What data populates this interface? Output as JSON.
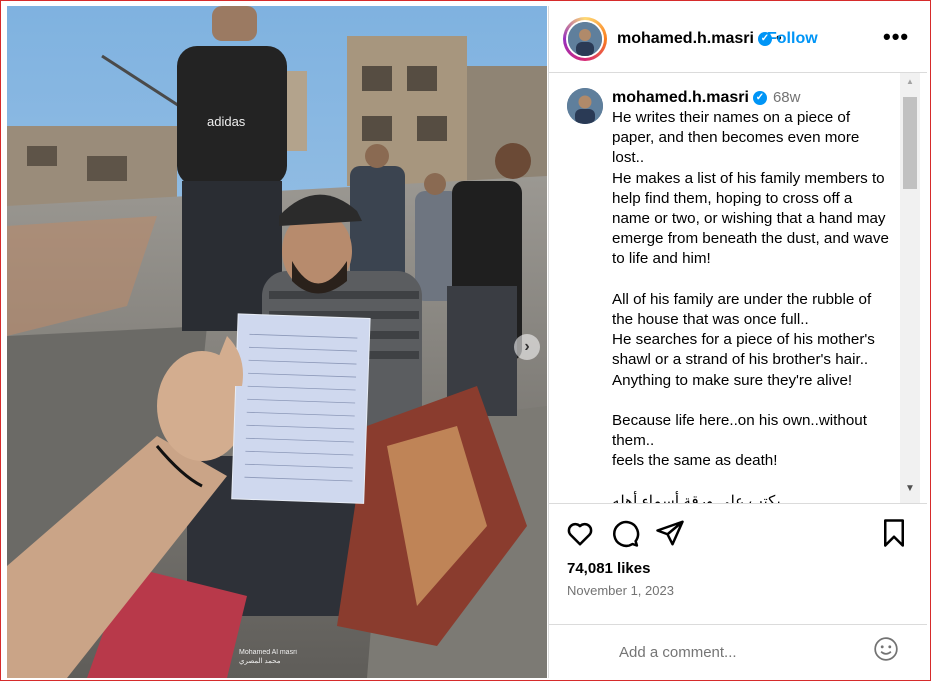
{
  "post": {
    "username": "mohamed.h.masri",
    "verified_icon": "verified-badge-icon",
    "follow_label": "Follow",
    "separator": "•",
    "more_label": "•••",
    "time_ago": "68w",
    "caption": "He writes their names on a piece of paper, and then becomes even more lost..\nHe makes a list of his family members to help find them, hoping to cross off a name or two, or wishing that a hand may emerge from beneath the dust, and wave to life and him!\n\nAll of his family are under the rubble of the house that was once full..\nHe searches for a piece of his mother's shawl or a strand of his brother's hair..\nAnything to make sure they're alive!\n\nBecause life here..on his own..without them..\nfeels the same as death!\n\nيكتب على ورقة أسماء أهله",
    "likes": "74,081 likes",
    "date": "November 1, 2023"
  },
  "photo": {
    "watermark_line1": "Mohamed Al masri",
    "watermark_line2": "محمد المصري"
  },
  "comment": {
    "placeholder": "Add a comment..."
  },
  "colors": {
    "accent": "#0095f6",
    "frame": "#d62b2b"
  }
}
